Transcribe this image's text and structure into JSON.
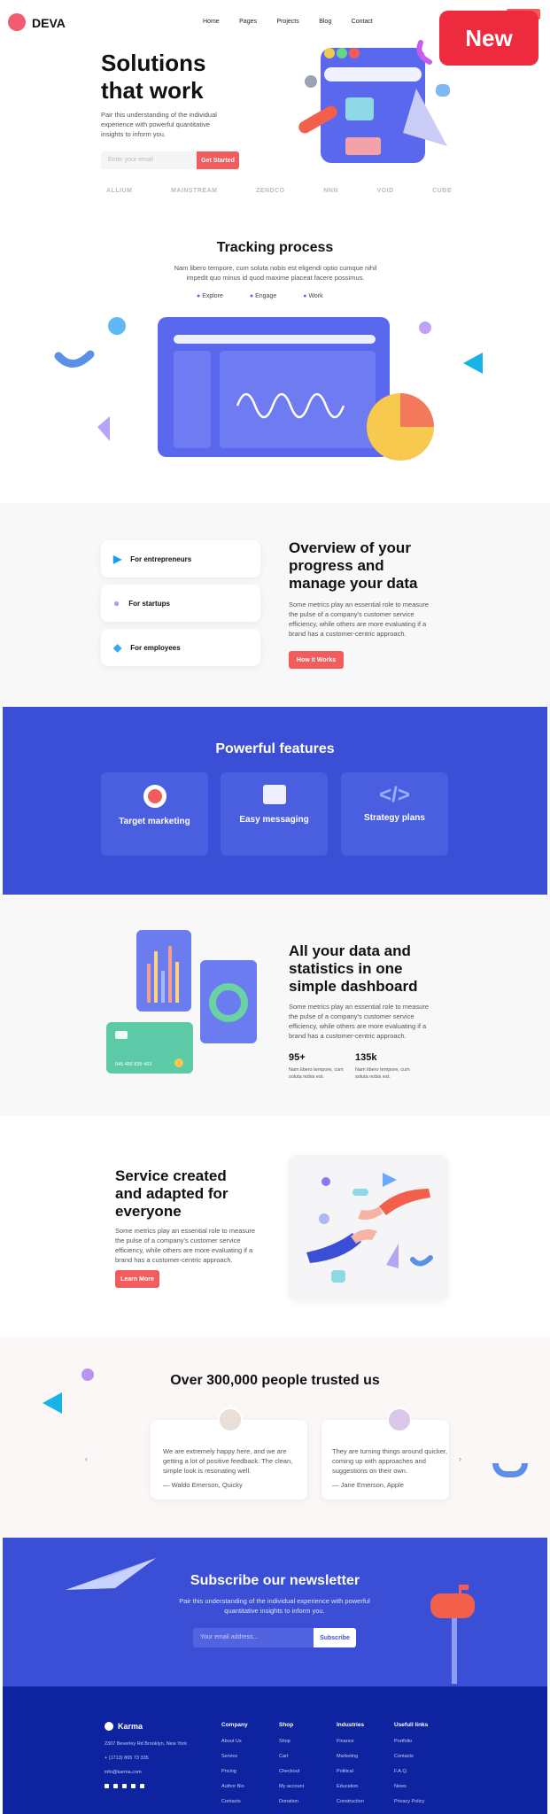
{
  "header": {
    "brand": "DEVA",
    "nav": [
      "Home",
      "Pages",
      "Projects",
      "Blog",
      "Contact"
    ],
    "badge": "New"
  },
  "hero": {
    "title_l1": "Solutions",
    "title_l2": "that work",
    "text": "Pair this understanding of the individual experience with powerful quantitative insights to inform you.",
    "placeholder": "Enter your email",
    "cta": "Get Started",
    "partners": [
      "ALLIUM",
      "MAINSTREAM",
      "ZENDCO",
      "NNN",
      "VOID",
      "CUBE"
    ]
  },
  "tracking": {
    "title": "Tracking process",
    "text": "Nam libero tempore, cum soluta nobis est eligendi optio cumque nihil impedit quo minus id quod maxime placeat facere possimus.",
    "tabs": [
      "Explore",
      "Engage",
      "Work"
    ]
  },
  "overview": {
    "items": [
      "For entrepreneurs",
      "For startups",
      "For employees"
    ],
    "title_l1": "Overview of your",
    "title_l2": "progress and",
    "title_l3": "manage your data",
    "text": "Some metrics play an essential role to measure the pulse of a company's customer service efficiency, while others are more evaluating if a brand has a customer-centric approach.",
    "cta": "How it Works"
  },
  "features": {
    "title": "Powerful features",
    "cards": [
      "Target marketing",
      "Easy messaging",
      "Strategy plans"
    ]
  },
  "dashboard": {
    "title_l1": "All your data and",
    "title_l2": "statistics in one",
    "title_l3": "simple dashboard",
    "text": "Some metrics play an essential role to measure the pulse of a company's customer service efficiency, while others are more evaluating if a brand has a customer-centric approach.",
    "stats": [
      {
        "value": "95+",
        "text": "Nam libero tempore, cum soluta nobis est."
      },
      {
        "value": "135k",
        "text": "Nam libero tempore, cum soluta nobis est."
      }
    ],
    "card_number": "045 456 839 403"
  },
  "service": {
    "title_l1": "Service created",
    "title_l2": "and adapted for",
    "title_l3": "everyone",
    "text": "Some metrics play an essential role to measure the pulse of a company's customer service efficiency, while others are more evaluating if a brand has a customer-centric approach.",
    "cta": "Learn More"
  },
  "testimonials": {
    "title": "Over 300,000 people trusted us",
    "items": [
      {
        "quote": "We are extremely happy here, and we are getting a lot of positive feedback. The clean, simple look is resonating well.",
        "author": "— Waldo Emerson, Quicky"
      },
      {
        "quote": "They are turning things around quicker, coming up with approaches and suggestions on their own.",
        "author": "— Jane Emerson, Apple"
      }
    ]
  },
  "newsletter": {
    "title": "Subscribe our newsletter",
    "text": "Pair this understanding of the individual experience with powerful quantitative insights to inform you.",
    "placeholder": "Your email address...",
    "cta": "Subscribe"
  },
  "footer": {
    "brand": "Karma",
    "address": "2307 Beverley Rd Brooklyn, New York",
    "phone": "+ (1713) 865 73 335",
    "email": "info@karma.com",
    "cols": [
      {
        "title": "Company",
        "links": [
          "About Us",
          "Service",
          "Pricing",
          "Author Bio",
          "Contacts"
        ]
      },
      {
        "title": "Shop",
        "links": [
          "Shop",
          "Cart",
          "Checkout",
          "My account",
          "Donation"
        ]
      },
      {
        "title": "Industries",
        "links": [
          "Finance",
          "Marketing",
          "Political",
          "Education",
          "Construction"
        ]
      },
      {
        "title": "Usefull links",
        "links": [
          "Portfolio",
          "Contacts",
          "F.A.Q.",
          "News",
          "Privacy Policy"
        ]
      }
    ]
  },
  "colors": {
    "accent": "#f25c5c",
    "primary": "#3b4fd6",
    "footer": "#0d23a0"
  }
}
